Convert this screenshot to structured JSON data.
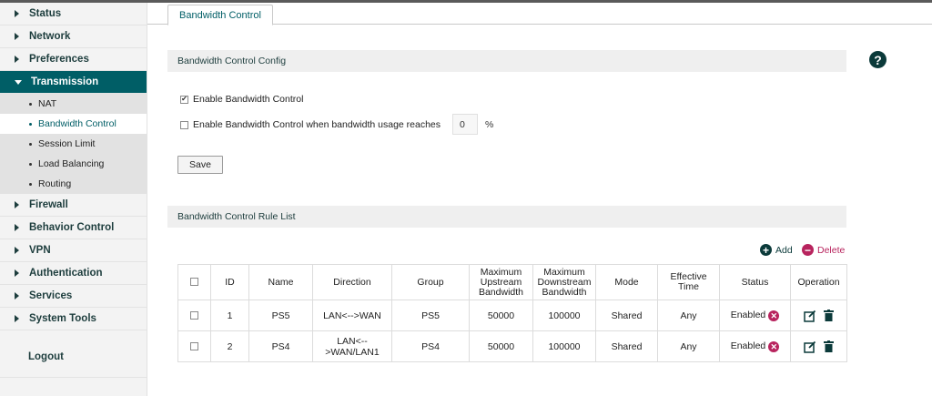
{
  "sidebar": {
    "items": [
      {
        "label": "Status"
      },
      {
        "label": "Network"
      },
      {
        "label": "Preferences"
      },
      {
        "label": "Transmission"
      },
      {
        "label": "Firewall"
      },
      {
        "label": "Behavior Control"
      },
      {
        "label": "VPN"
      },
      {
        "label": "Authentication"
      },
      {
        "label": "Services"
      },
      {
        "label": "System Tools"
      }
    ],
    "transmission_sub": [
      {
        "label": "NAT"
      },
      {
        "label": "Bandwidth Control"
      },
      {
        "label": "Session Limit"
      },
      {
        "label": "Load Balancing"
      },
      {
        "label": "Routing"
      }
    ],
    "logout": "Logout"
  },
  "tab": {
    "label": "Bandwidth Control"
  },
  "help_icon": "?",
  "config": {
    "section_title": "Bandwidth Control Config",
    "enable_label": "Enable Bandwidth Control",
    "enable_checked": true,
    "threshold_label": "Enable Bandwidth Control when bandwidth usage reaches",
    "threshold_checked": false,
    "threshold_value": "0",
    "threshold_unit": "%",
    "save_label": "Save"
  },
  "rules": {
    "section_title": "Bandwidth Control Rule List",
    "add_label": "Add",
    "delete_label": "Delete",
    "columns": [
      "ID",
      "Name",
      "Direction",
      "Group",
      "Maximum Upstream Bandwidth",
      "Maximum Downstream Bandwidth",
      "Mode",
      "Effective Time",
      "Status",
      "Operation"
    ],
    "rows": [
      {
        "id": "1",
        "name": "PS5",
        "direction": "LAN<-->WAN",
        "group": "PS5",
        "up": "50000",
        "down": "100000",
        "mode": "Shared",
        "time": "Any",
        "status": "Enabled"
      },
      {
        "id": "2",
        "name": "PS4",
        "direction": "LAN<-->WAN/LAN1",
        "group": "PS4",
        "up": "50000",
        "down": "100000",
        "mode": "Shared",
        "time": "Any",
        "status": "Enabled"
      }
    ]
  },
  "colors": {
    "accent": "#005e66",
    "delete": "#b8245e",
    "add": "#0b3a3a"
  }
}
